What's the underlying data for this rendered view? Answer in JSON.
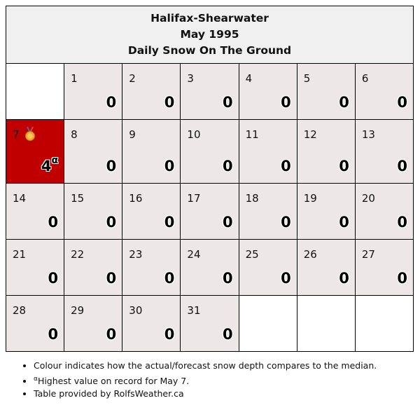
{
  "header": {
    "station": "Halifax-Shearwater",
    "period": "May 1995",
    "subject": "Daily Snow On The Ground"
  },
  "days": [
    {
      "day": "1",
      "value": "0"
    },
    {
      "day": "2",
      "value": "0"
    },
    {
      "day": "3",
      "value": "0"
    },
    {
      "day": "4",
      "value": "0"
    },
    {
      "day": "5",
      "value": "0"
    },
    {
      "day": "6",
      "value": "0"
    },
    {
      "day": "7",
      "value": "4",
      "marker": "α",
      "icon": "medal-icon",
      "color": "#c00000"
    },
    {
      "day": "8",
      "value": "0"
    },
    {
      "day": "9",
      "value": "0"
    },
    {
      "day": "10",
      "value": "0"
    },
    {
      "day": "11",
      "value": "0"
    },
    {
      "day": "12",
      "value": "0"
    },
    {
      "day": "13",
      "value": "0"
    },
    {
      "day": "14",
      "value": "0"
    },
    {
      "day": "15",
      "value": "0"
    },
    {
      "day": "16",
      "value": "0"
    },
    {
      "day": "17",
      "value": "0"
    },
    {
      "day": "18",
      "value": "0"
    },
    {
      "day": "19",
      "value": "0"
    },
    {
      "day": "20",
      "value": "0"
    },
    {
      "day": "21",
      "value": "0"
    },
    {
      "day": "22",
      "value": "0"
    },
    {
      "day": "23",
      "value": "0"
    },
    {
      "day": "24",
      "value": "0"
    },
    {
      "day": "25",
      "value": "0"
    },
    {
      "day": "26",
      "value": "0"
    },
    {
      "day": "27",
      "value": "0"
    },
    {
      "day": "28",
      "value": "0"
    },
    {
      "day": "29",
      "value": "0"
    },
    {
      "day": "30",
      "value": "0"
    },
    {
      "day": "31",
      "value": "0"
    }
  ],
  "notes": {
    "colour": "Colour indicates how the actual/forecast snow depth compares to the median.",
    "record_marker": "α",
    "record": "Highest value on record for May 7.",
    "credit": "Table provided by RolfsWeather.ca"
  },
  "colors": {
    "normal_cell": "#ede7e7",
    "record_cell": "#c00000",
    "header_bg": "#f0f0f0"
  }
}
